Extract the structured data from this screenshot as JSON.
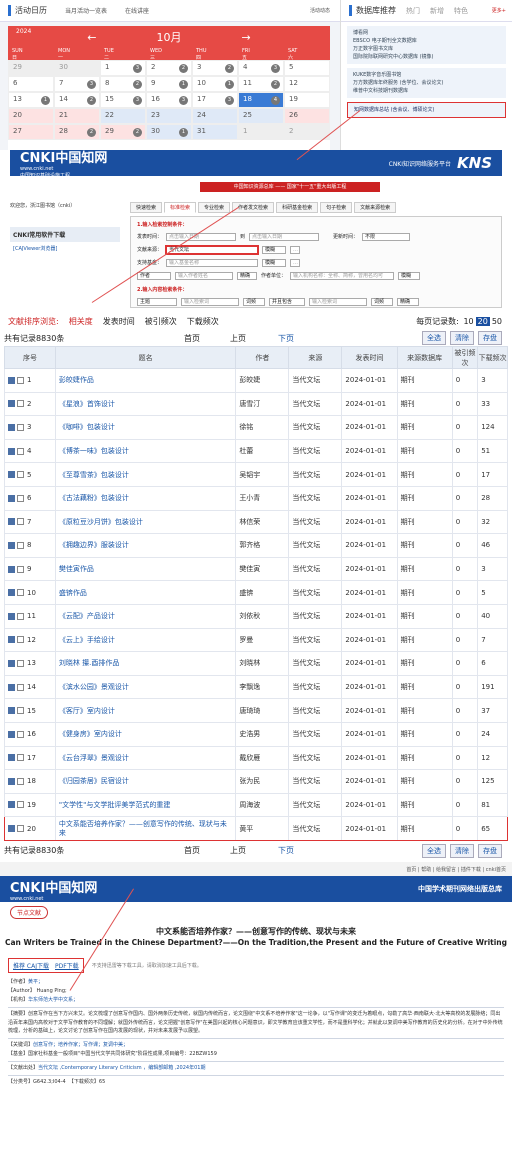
{
  "calendar_panel": {
    "tabs": [
      "活动日历",
      "当月活动一览表",
      "在线讲座"
    ],
    "right_link": "活动动态",
    "year": "2024",
    "month": "10月",
    "weekdays": [
      [
        "SUN",
        "日"
      ],
      [
        "MON",
        "一"
      ],
      [
        "TUE",
        "二"
      ],
      [
        "WED",
        "三"
      ],
      [
        "THU",
        "四"
      ],
      [
        "FRI",
        "五"
      ],
      [
        "SAT",
        "六"
      ]
    ],
    "days": [
      {
        "d": "29",
        "c": "gr"
      },
      {
        "d": "30",
        "c": "gr"
      },
      {
        "d": "1",
        "c": "",
        "b": "3"
      },
      {
        "d": "2",
        "c": "",
        "b": "2"
      },
      {
        "d": "3",
        "c": "",
        "b": "2"
      },
      {
        "d": "4",
        "c": "",
        "b": "3"
      },
      {
        "d": "5",
        "c": ""
      },
      {
        "d": "6",
        "c": ""
      },
      {
        "d": "7",
        "c": "",
        "b": "3"
      },
      {
        "d": "8",
        "c": "",
        "b": "2"
      },
      {
        "d": "9",
        "c": "",
        "b": "1"
      },
      {
        "d": "10",
        "c": "",
        "b": "1"
      },
      {
        "d": "11",
        "c": "",
        "b": "2"
      },
      {
        "d": "12",
        "c": ""
      },
      {
        "d": "13",
        "c": "",
        "b": "1"
      },
      {
        "d": "14",
        "c": "",
        "b": "2"
      },
      {
        "d": "15",
        "c": "",
        "b": "3"
      },
      {
        "d": "16",
        "c": "",
        "b": "3"
      },
      {
        "d": "17",
        "c": "",
        "b": "3"
      },
      {
        "d": "18",
        "c": "td",
        "b": "4"
      },
      {
        "d": "19",
        "c": ""
      },
      {
        "d": "20",
        "c": "pk"
      },
      {
        "d": "21",
        "c": "pk"
      },
      {
        "d": "22",
        "c": "bl"
      },
      {
        "d": "23",
        "c": "bl"
      },
      {
        "d": "24",
        "c": "bl"
      },
      {
        "d": "25",
        "c": "bl"
      },
      {
        "d": "26",
        "c": "pk"
      },
      {
        "d": "27",
        "c": "pk"
      },
      {
        "d": "28",
        "c": "pk",
        "b": "2"
      },
      {
        "d": "29",
        "c": "pk",
        "b": "2"
      },
      {
        "d": "30",
        "c": "bl",
        "b": "1"
      },
      {
        "d": "31",
        "c": "bl"
      },
      {
        "d": "1",
        "c": "gr"
      },
      {
        "d": "2",
        "c": "gr"
      }
    ]
  },
  "recommend": {
    "title": "数据库推荐",
    "tabs": [
      "热门",
      "新增",
      "特色"
    ],
    "more": "更多+",
    "groups": [
      [
        "博看网",
        "EBSCO 电子期刊全文数据库",
        "万正数字图书文库",
        "国际院际联网研究中心数据库 (镜像)"
      ],
      [
        "KUKE数字音乐图书馆",
        "万方数据库年终服务 (含学位、会议论文)",
        "维普中文科技期刊数据库"
      ],
      [
        "知网数据库总站 (含会议、博硕论文)"
      ]
    ]
  },
  "cnki": {
    "logo": "CNKI中国知网",
    "logo_url": "www.cnki.net",
    "logo_sub": "中国知识基础设施工程",
    "platform": "CNKI知识网络服务平台",
    "kns": "KNS",
    "subtitle": "中国知识资源总库 —— 国家\"十一五\"重大出版工程",
    "welcome": "欢迎您，浙江图书馆（cnki）",
    "sidebar_title": "CNKI常用软件下载",
    "sidebar_item": "[CAJViewer浏览器]",
    "search_tabs": [
      "快速检索",
      "标准检索",
      "专业检索",
      "作者发文检索",
      "科研基金检索",
      "句子检索",
      "文献来源检索"
    ],
    "step1": "1.输入检索控制条件：",
    "time_label": "发表时间：",
    "from_ph": "点击输入日期",
    "to_label": "到",
    "update_label": "更新时间：",
    "update_val": "不限",
    "source_label": "文献来源：",
    "source_val": "当代文坛",
    "match": "模糊",
    "fund_label": "支持基金：",
    "fund_ph": "输入基金名称",
    "author_sel": "作者",
    "author_ph": "输入作者姓名",
    "exact": "精确",
    "org_label": "作者单位：",
    "org_ph": "输入机构名称：全称、简称，曾用名均可",
    "step2": "2.输入内容检索条件：",
    "topic_sel": "主题",
    "kw_ph": "输入检索词",
    "freq": "词频",
    "and": "并且包含",
    "freq2": "词频",
    "exact2": "精确"
  },
  "results": {
    "sort_label": "文献排序浏览:",
    "sort_opts": [
      "相关度",
      "发表时间",
      "被引频次",
      "下载频次"
    ],
    "per_page_label": "每页记录数:",
    "per_page": [
      "10",
      "20",
      "50"
    ],
    "total": "共有记录8830条",
    "first": "首页",
    "prev": "上页",
    "next": "下页",
    "btn_all": "全选",
    "btn_clear": "清除",
    "btn_save": "存盘",
    "headers": [
      "序号",
      "题名",
      "作者",
      "来源",
      "发表时间",
      "来源数据库",
      "被引频次",
      "下载频次"
    ],
    "rows": [
      [
        "1",
        "彭皎婕作品",
        "彭皎婕",
        "当代文坛",
        "2024-01-01",
        "期刊",
        "0",
        "3"
      ],
      [
        "2",
        "《星浪》首饰设计",
        "唐雪汀",
        "当代文坛",
        "2024-01-01",
        "期刊",
        "0",
        "33"
      ],
      [
        "3",
        "《咖啡》包装设计",
        "徐铭",
        "当代文坛",
        "2024-01-01",
        "期刊",
        "0",
        "124"
      ],
      [
        "4",
        "《博茶一味》包装设计",
        "杜蕾",
        "当代文坛",
        "2024-01-01",
        "期刊",
        "0",
        "51"
      ],
      [
        "5",
        "《至尊雪茶》包装设计",
        "吴韬宇",
        "当代文坛",
        "2024-01-01",
        "期刊",
        "0",
        "17"
      ],
      [
        "6",
        "《古法藕粉》包装设计",
        "王小青",
        "当代文坛",
        "2024-01-01",
        "期刊",
        "0",
        "28"
      ],
      [
        "7",
        "《原粒豆沙月饼》包装设计",
        "林信荣",
        "当代文坛",
        "2024-01-01",
        "期刊",
        "0",
        "32"
      ],
      [
        "8",
        "《拥趣边界》服装设计",
        "郭齐格",
        "当代文坛",
        "2024-01-01",
        "期刊",
        "0",
        "46"
      ],
      [
        "9",
        "樊佳寅作品",
        "樊佳寅",
        "当代文坛",
        "2024-01-01",
        "期刊",
        "0",
        "3"
      ],
      [
        "10",
        "盛锛作品",
        "盛锛",
        "当代文坛",
        "2024-01-01",
        "期刊",
        "0",
        "5"
      ],
      [
        "11",
        "《云配》产品设计",
        "刘依秋",
        "当代文坛",
        "2024-01-01",
        "期刊",
        "0",
        "40"
      ],
      [
        "12",
        "《云上》手绘设计",
        "罗曼",
        "当代文坛",
        "2024-01-01",
        "期刊",
        "0",
        "7"
      ],
      [
        "13",
        "刘晓林 攥.酉排作品",
        "刘晓林",
        "当代文坛",
        "2024-01-01",
        "期刊",
        "0",
        "6"
      ],
      [
        "14",
        "《滨水公园》景观设计",
        "李飘逸",
        "当代文坛",
        "2024-01-01",
        "期刊",
        "0",
        "191"
      ],
      [
        "15",
        "《客厅》室内设计",
        "唐琦琦",
        "当代文坛",
        "2024-01-01",
        "期刊",
        "0",
        "37"
      ],
      [
        "16",
        "《健身房》室内设计",
        "史浩男",
        "当代文坛",
        "2024-01-01",
        "期刊",
        "0",
        "24"
      ],
      [
        "17",
        "《云台浮翠》景观设计",
        "戴欣雁",
        "当代文坛",
        "2024-01-01",
        "期刊",
        "0",
        "12"
      ],
      [
        "18",
        "《归园茶居》民宿设计",
        "张为民",
        "当代文坛",
        "2024-01-01",
        "期刊",
        "0",
        "125"
      ],
      [
        "19",
        "\"文学性\"与文学批评美学范式的重建",
        "周海波",
        "当代文坛",
        "2024-01-01",
        "期刊",
        "0",
        "81"
      ],
      [
        "20",
        "中文系能否培养作家？——创意写作的传统、现状与未来",
        "黄平",
        "当代文坛",
        "2024-01-01",
        "期刊",
        "0",
        "65"
      ]
    ]
  },
  "detail": {
    "toplinks": "首页 | 帮助 | 给我留言 | 插件下载 | cnki首页",
    "logo": "CNKI中国知网",
    "logo_url": "www.cnki.net",
    "brand": "中国学术期刊网络出版总库",
    "node": "节点文献",
    "title_cn": "中文系能否培养作家？——创意写作的传统、现状与未来",
    "title_en": "Can Writers be Trained in the Chinese Department?——On the Tradition,the Present and the Future of Creative Writing",
    "caj": "推荐 CAJ下载",
    "pdf": "PDF下载",
    "hint": "不支持迅雷等下载工具，请取消加速工具后下载。",
    "author_label": "【作者】",
    "author": "黄平；",
    "author_en_label": "【Author】",
    "author_en": "Huang Ping;",
    "org_label": "【机构】",
    "org": "华东师范大学中文系；",
    "abstract_label": "【摘要】",
    "abstract": "创意写作在当下方兴未艾。论文梳理了创意写作国内、国外两条历史传统，就国内传统而言，论文围绕\"中文系不培养作家\"这一论争，以\"写作课\"的变迁为着眼点，勾勒了高华·西南联大·北大等高校的发展脉络；同出沿百年来国内高校对于文学写作教育的不同理解；就国外传统而言，论文把握\"创意写作\"在美国兴起的核心问题意识，即文学教育应该重文学性，而不是重科学化；并就此以复调中美写作教育的历史化的分析。在对于中外传统梳理，分析的基础上，论文讨论了创意写作在国内发展的现状，并对未来发展予以展望。",
    "kw_label": "【关键词】",
    "keywords": "创意写作；培养作家；写作课；复调中美；",
    "fund_label": "【基金】",
    "fund": "国家社科基金一般项目\"中国当代文学共同体研究\"阶段性成果,项目编号：22BZW159",
    "src_label": "【文献出处】",
    "src": "当代文坛 ,Contemporary Literary Criticism ，编辑部邮箱 ,2024年01期",
    "cls_label": "【分类号】",
    "cls": "G642.3;I04-4",
    "dl_label": "【下载频次】",
    "dl": "65"
  },
  "colors": {
    "accent": "#1a4fa0",
    "highlight": "#d33333",
    "calendar_red": "#e64a45"
  }
}
